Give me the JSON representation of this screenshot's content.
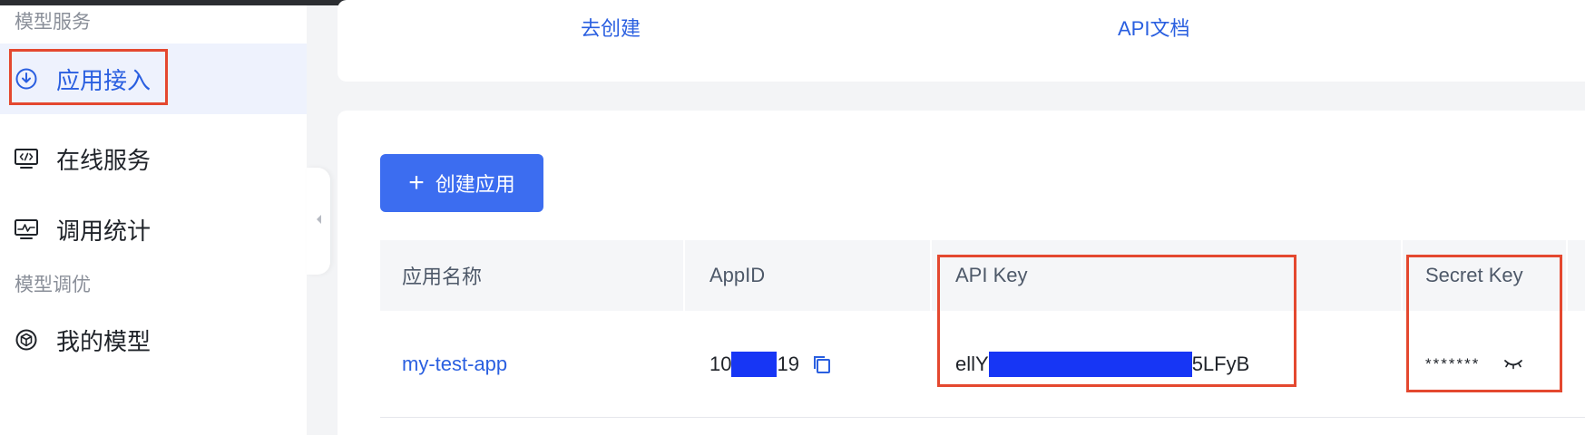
{
  "sidebar": {
    "section_service": "模型服务",
    "section_tuning": "模型调优",
    "items": [
      {
        "label": "应用接入",
        "icon": "download-circle-icon",
        "active": true
      },
      {
        "label": "在线服务",
        "icon": "monitor-code-icon",
        "active": false
      },
      {
        "label": "调用统计",
        "icon": "monitor-chart-icon",
        "active": false
      },
      {
        "label": "我的模型",
        "icon": "model-cube-icon",
        "active": false
      }
    ]
  },
  "top_card": {
    "create_link": "去创建",
    "api_doc_link": "API文档"
  },
  "main": {
    "create_button": "创建应用",
    "table": {
      "columns": [
        "应用名称",
        "AppID",
        "API Key",
        "Secret Key"
      ],
      "rows": [
        {
          "name": "my-test-app",
          "appid_prefix": "10",
          "appid_suffix": "19",
          "api_key_prefix": "ellY",
          "api_key_suffix": "5LFyB",
          "secret_key": "*******"
        }
      ]
    }
  },
  "colors": {
    "accent": "#2a5fe0",
    "button": "#3c6df0",
    "highlight_box": "#e4482f",
    "redaction": "#1736f5"
  }
}
